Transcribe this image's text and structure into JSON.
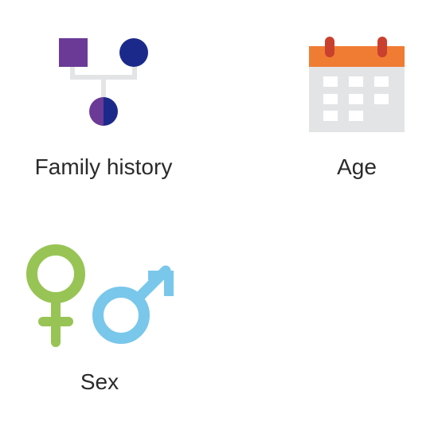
{
  "factors": {
    "family_history": {
      "label": "Family history",
      "icon": "family-tree-icon",
      "colors": {
        "purple": "#6B3A96",
        "navy": "#1B2A8A",
        "connector": "#E3E4E6"
      }
    },
    "age": {
      "label": "Age",
      "icon": "calendar-icon",
      "colors": {
        "header": "#F07C33",
        "rings": "#C9402E",
        "body": "#E3E4E6",
        "cells": "#ffffff"
      }
    },
    "sex": {
      "label": "Sex",
      "icon": "gender-symbols-icon",
      "colors": {
        "female": "#98C455",
        "male": "#79C7EA"
      }
    }
  }
}
